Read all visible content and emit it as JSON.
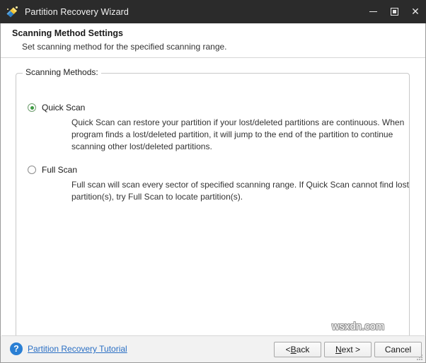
{
  "window": {
    "title": "Partition Recovery Wizard",
    "app_icon": "wizard-wand-icon",
    "controls": {
      "minimize": "minimize-icon",
      "maximize": "maximize-icon",
      "close": "close-icon"
    }
  },
  "header": {
    "title": "Scanning Method Settings",
    "subtitle": "Set scanning method for the specified scanning range."
  },
  "group": {
    "legend": "Scanning Methods:",
    "options": [
      {
        "id": "quick-scan",
        "label": "Quick Scan",
        "selected": true,
        "description": "Quick Scan can restore your partition if your lost/deleted partitions are continuous. When program finds a lost/deleted partition, it will jump to the end of the partition to continue scanning other lost/deleted partitions."
      },
      {
        "id": "full-scan",
        "label": "Full Scan",
        "selected": false,
        "description": "Full scan will scan every sector of specified scanning range. If Quick Scan cannot find lost partition(s), try Full Scan to locate partition(s)."
      }
    ]
  },
  "footer": {
    "help_icon": "question-mark-icon",
    "tutorial_link": "Partition Recovery Tutorial",
    "buttons": {
      "back": {
        "prefix": "< ",
        "accel": "B",
        "suffix": "ack"
      },
      "next": {
        "prefix": "",
        "accel": "N",
        "suffix": "ext >"
      },
      "cancel": {
        "label": "Cancel"
      }
    }
  },
  "watermark": "wsxdn.com",
  "colors": {
    "titlebar_bg": "#2b2b2b",
    "radio_selected": "#3e9b43",
    "link": "#2a6fc4",
    "help_icon_bg": "#2a7fd4",
    "footer_bg": "#f2f2f2"
  }
}
